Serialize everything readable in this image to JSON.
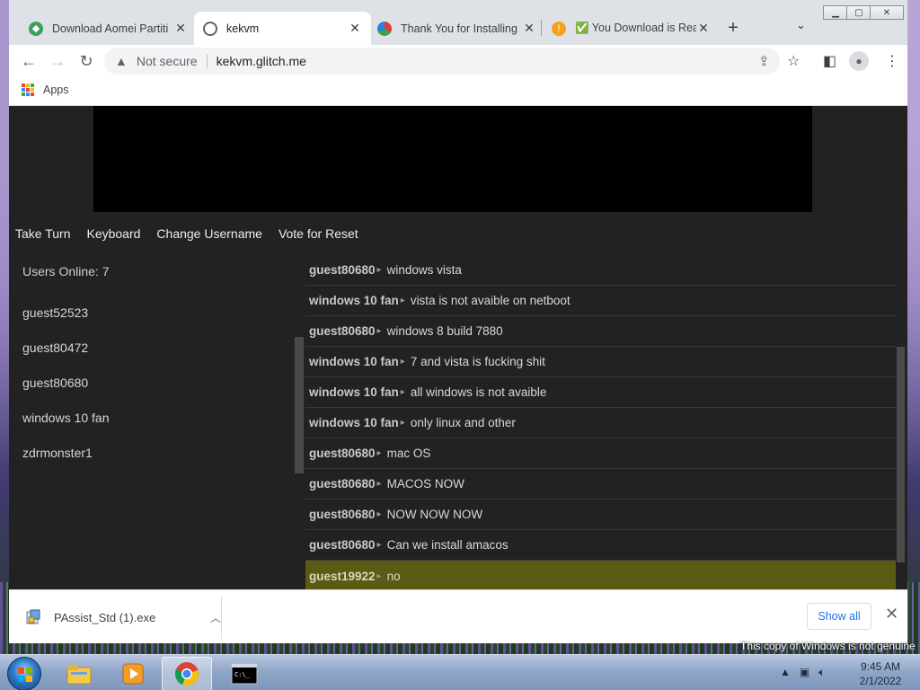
{
  "browser": {
    "tabs": [
      {
        "title": "Download Aomei Partiti",
        "favicon": "aomei-icon",
        "active": false
      },
      {
        "title": "kekvm",
        "favicon": "globe-icon",
        "active": true
      },
      {
        "title": "Thank You for Installing",
        "favicon": "multicolor-icon",
        "active": false
      },
      {
        "title": "✅ You Download is Rea",
        "favicon": "warning-icon",
        "active": false
      }
    ],
    "new_tab": "+",
    "address": {
      "security": "Not secure",
      "url": "kekvm.glitch.me"
    },
    "bookmarks": {
      "apps_label": "Apps"
    }
  },
  "page": {
    "vm_buttons": [
      "Take Turn",
      "Keyboard",
      "Change Username",
      "Vote for Reset"
    ],
    "users_online_label": "Users Online: 7",
    "users": [
      "guest52523",
      "guest80472",
      "guest80680",
      "windows 10 fan",
      "zdrmonster1"
    ],
    "chat": [
      {
        "user": "guest80680",
        "text": "windows vista"
      },
      {
        "user": "windows 10 fan",
        "text": "vista is not avaible on netboot"
      },
      {
        "user": "guest80680",
        "text": "windows 8 build 7880"
      },
      {
        "user": "windows 10 fan",
        "text": "7 and vista is fucking shit"
      },
      {
        "user": "windows 10 fan",
        "text": "all windows is not avaible"
      },
      {
        "user": "windows 10 fan",
        "text": "only linux and other"
      },
      {
        "user": "guest80680",
        "text": "mac OS"
      },
      {
        "user": "guest80680",
        "text": "MACOS NOW"
      },
      {
        "user": "guest80680",
        "text": "NOW NOW NOW"
      },
      {
        "user": "guest80680",
        "text": "Can we install amacos"
      },
      {
        "user": "guest19922",
        "text": "no",
        "highlight": true
      }
    ]
  },
  "downloads": {
    "file": "PAssist_Std (1).exe",
    "show_all": "Show all"
  },
  "desktop": {
    "watermark": "This copy of Windows is not genuine"
  },
  "taskbar": {
    "apps": [
      "explorer-icon",
      "media-player-icon",
      "chrome-icon",
      "cmd-icon"
    ],
    "clock_time": "9:45 AM",
    "clock_date": "2/1/2022"
  },
  "colors": {
    "page_bg": "#222222",
    "highlight_row": "#5b5b14",
    "link_blue": "#1a73e8"
  }
}
